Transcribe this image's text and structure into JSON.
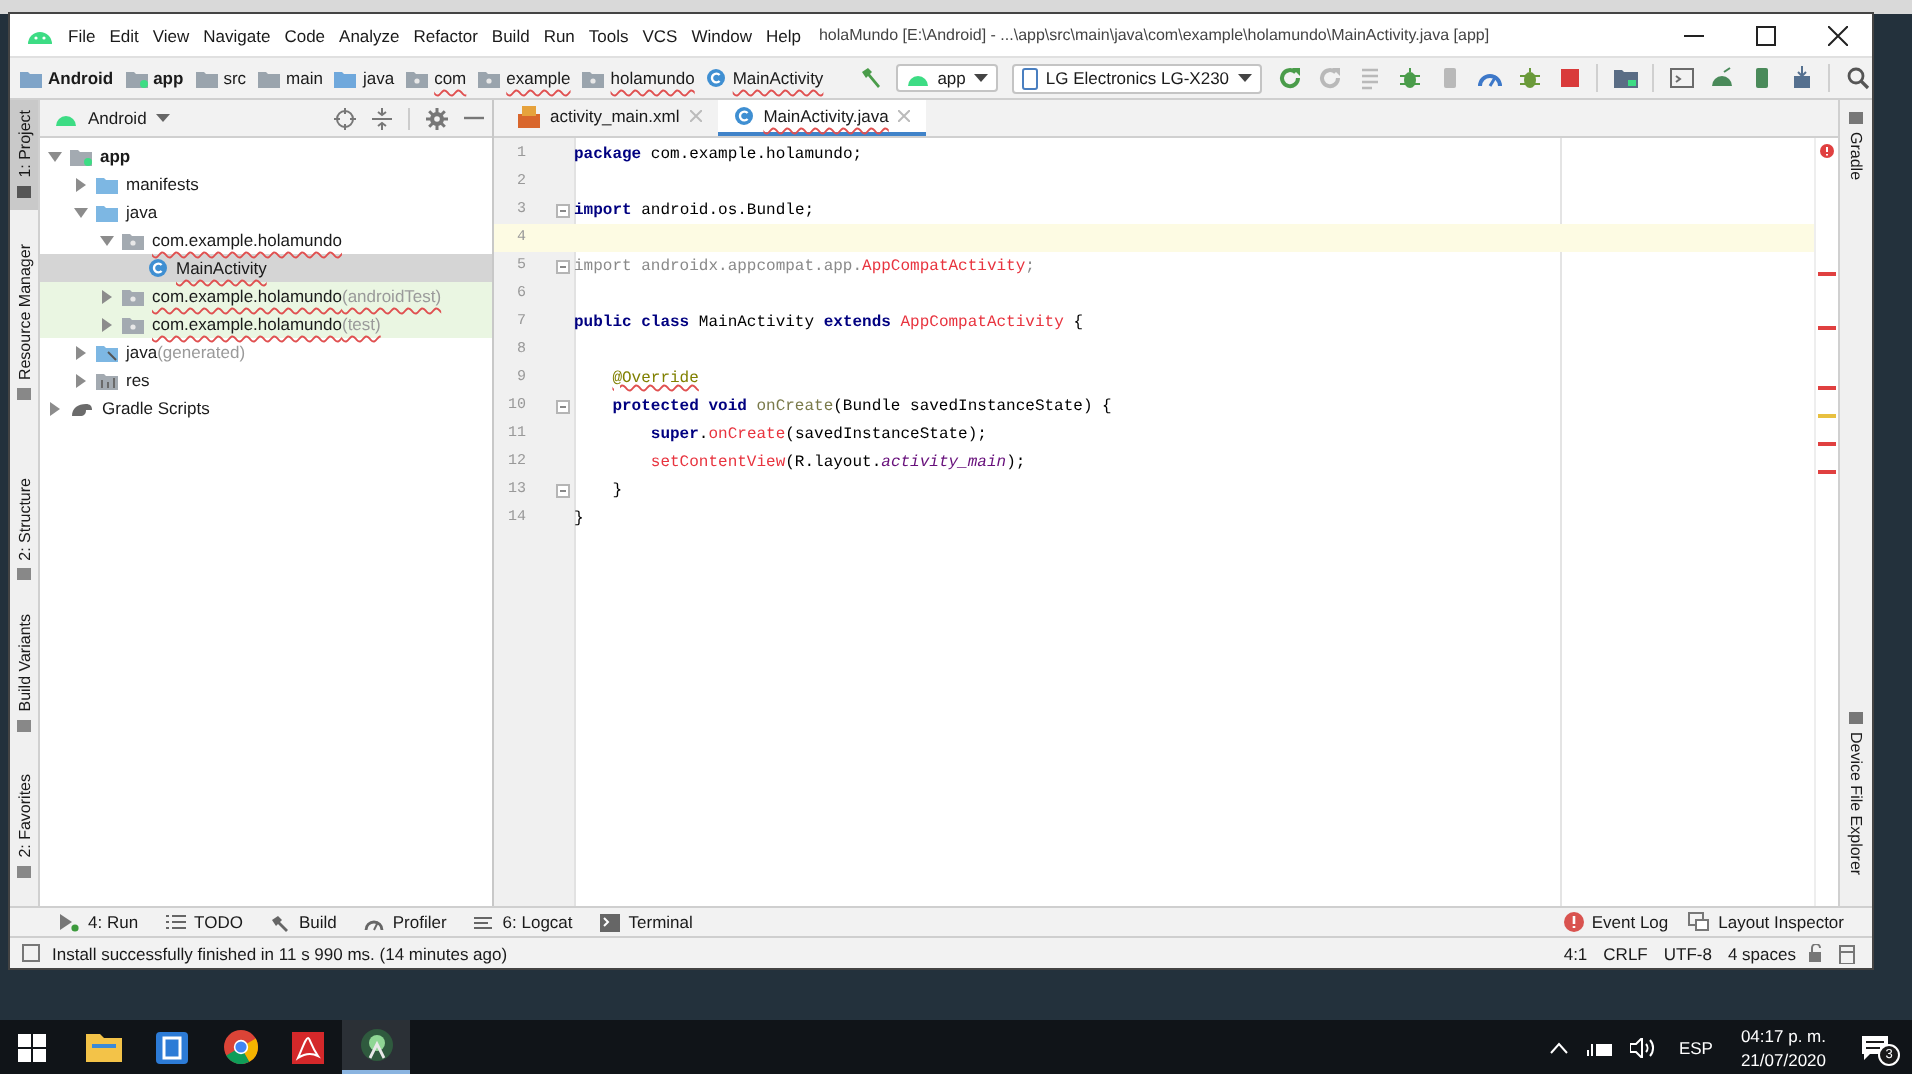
{
  "window": {
    "title": "holaMundo [E:\\Android] - ...\\app\\src\\main\\java\\com\\example\\holamundo\\MainActivity.java [app]"
  },
  "menu": [
    "File",
    "Edit",
    "View",
    "Navigate",
    "Code",
    "Analyze",
    "Refactor",
    "Build",
    "Run",
    "Tools",
    "VCS",
    "Window",
    "Help"
  ],
  "breadcrumb": [
    {
      "label": "Android",
      "kind": "project"
    },
    {
      "label": "app",
      "kind": "module"
    },
    {
      "label": "src",
      "kind": "folder"
    },
    {
      "label": "main",
      "kind": "folder"
    },
    {
      "label": "java",
      "kind": "source-folder"
    },
    {
      "label": "com",
      "kind": "package"
    },
    {
      "label": "example",
      "kind": "package"
    },
    {
      "label": "holamundo",
      "kind": "package"
    },
    {
      "label": "MainActivity",
      "kind": "class"
    }
  ],
  "run_config": {
    "module": "app",
    "device": "LG Electronics LG-X230"
  },
  "left_tool_tabs": [
    {
      "label": "1: Project",
      "selected": true
    },
    {
      "label": "Resource Manager",
      "selected": false
    },
    {
      "label": "2: Structure",
      "selected": false
    },
    {
      "label": "Build Variants",
      "selected": false
    },
    {
      "label": "2: Favorites",
      "selected": false
    }
  ],
  "project_panel": {
    "view": "Android",
    "tree": [
      {
        "label": "app",
        "kind": "module",
        "expanded": true,
        "selected": false,
        "children": [
          {
            "label": "manifests",
            "kind": "folder",
            "expanded": false,
            "selected": false
          },
          {
            "label": "java",
            "kind": "folder",
            "expanded": true,
            "selected": false,
            "children": [
              {
                "label": "com.example.holamundo",
                "kind": "package",
                "expanded": true,
                "selected": false,
                "children": [
                  {
                    "label": "MainActivity",
                    "kind": "class",
                    "selected": true
                  }
                ]
              },
              {
                "label": "com.example.holamundo",
                "note": "(androidTest)",
                "kind": "test-package",
                "expanded": false,
                "selected": false
              },
              {
                "label": "com.example.holamundo",
                "note": "(test)",
                "kind": "test-package",
                "expanded": false,
                "selected": false
              }
            ]
          },
          {
            "label": "java",
            "note": "(generated)",
            "kind": "generated-folder",
            "expanded": false,
            "selected": false
          },
          {
            "label": "res",
            "kind": "res-folder",
            "expanded": false,
            "selected": false
          }
        ]
      },
      {
        "label": "Gradle Scripts",
        "kind": "gradle",
        "expanded": false,
        "selected": false
      }
    ]
  },
  "editor_tabs": [
    {
      "label": "activity_main.xml",
      "kind": "xml",
      "selected": false
    },
    {
      "label": "MainActivity.java",
      "kind": "java",
      "selected": true
    }
  ],
  "code_lines": [
    {
      "number": "1",
      "current": false,
      "fold": false,
      "tokens": [
        {
          "kind": "keyword",
          "text": "package"
        },
        {
          "kind": "plain",
          "text": " com.example.holamundo;"
        }
      ]
    },
    {
      "number": "2",
      "current": false,
      "fold": false
    },
    {
      "number": "3",
      "current": false,
      "fold": true,
      "tokens": [
        {
          "kind": "keyword",
          "text": "import"
        },
        {
          "kind": "plain",
          "text": " android.os.Bundle;"
        }
      ]
    },
    {
      "number": "4",
      "current": true,
      "fold": false
    },
    {
      "number": "5",
      "current": false,
      "fold": true,
      "tokens": [
        {
          "kind": "unused",
          "text": "import androidx.appcompat.app."
        },
        {
          "kind": "error",
          "text": "AppCompatActivity"
        },
        {
          "kind": "unused",
          "text": ";"
        }
      ]
    },
    {
      "number": "6",
      "current": false,
      "fold": false
    },
    {
      "number": "7",
      "current": false,
      "fold": false,
      "tokens": [
        {
          "kind": "keyword",
          "text": "public class"
        },
        {
          "kind": "plain",
          "text": " MainActivity "
        },
        {
          "kind": "keyword",
          "text": "extends "
        },
        {
          "kind": "error",
          "text": "AppCompatActivity"
        },
        {
          "kind": "plain",
          "text": " {"
        }
      ]
    },
    {
      "number": "8",
      "current": false,
      "fold": false
    },
    {
      "number": "9",
      "current": false,
      "fold": false,
      "tokens": [
        {
          "kind": "annotation",
          "text": "    @Override"
        }
      ]
    },
    {
      "number": "10",
      "current": false,
      "fold": true,
      "tokens": [
        {
          "kind": "keyword",
          "text": "    protected void "
        },
        {
          "kind": "declaration",
          "text": "onCreate"
        },
        {
          "kind": "plain",
          "text": "(Bundle savedInstanceState) {"
        }
      ]
    },
    {
      "number": "11",
      "current": false,
      "fold": false,
      "tokens": [
        {
          "kind": "keyword",
          "text": "        super"
        },
        {
          "kind": "plain",
          "text": "."
        },
        {
          "kind": "error",
          "text": "onCreate"
        },
        {
          "kind": "plain",
          "text": "(savedInstanceState);"
        }
      ]
    },
    {
      "number": "12",
      "current": false,
      "fold": false,
      "tokens": [
        {
          "kind": "error",
          "text": "        setContentView"
        },
        {
          "kind": "plain",
          "text": "(R.layout."
        },
        {
          "kind": "static",
          "text": "activity_main"
        },
        {
          "kind": "plain",
          "text": ");"
        }
      ]
    },
    {
      "number": "13",
      "current": false,
      "fold": true,
      "tokens": [
        {
          "kind": "plain",
          "text": "    }"
        }
      ]
    },
    {
      "number": "14",
      "current": false,
      "fold": false,
      "tokens": [
        {
          "kind": "plain",
          "text": "}"
        }
      ]
    }
  ],
  "right_tool_tabs": [
    "Gradle",
    "Device File Explorer"
  ],
  "bottom_tools": [
    {
      "label": "4: Run",
      "kind": "run"
    },
    {
      "label": "TODO",
      "kind": "todo"
    },
    {
      "label": "Build",
      "kind": "build"
    },
    {
      "label": "Profiler",
      "kind": "profiler"
    },
    {
      "label": "6: Logcat",
      "kind": "logcat"
    },
    {
      "label": "Terminal",
      "kind": "terminal"
    }
  ],
  "bottom_right_tools": [
    {
      "label": "Event Log",
      "kind": "event-log"
    },
    {
      "label": "Layout Inspector",
      "kind": "layout-inspector"
    }
  ],
  "status_bar": {
    "message": "Install successfully finished in 11 s 990 ms. (14 minutes ago)",
    "items": [
      "4:1",
      "CRLF",
      "UTF-8",
      "4 spaces"
    ]
  },
  "taskbar": {
    "language": "ESP",
    "time": "04:17 p. m.",
    "date": "21/07/2020",
    "notifications": "3"
  }
}
